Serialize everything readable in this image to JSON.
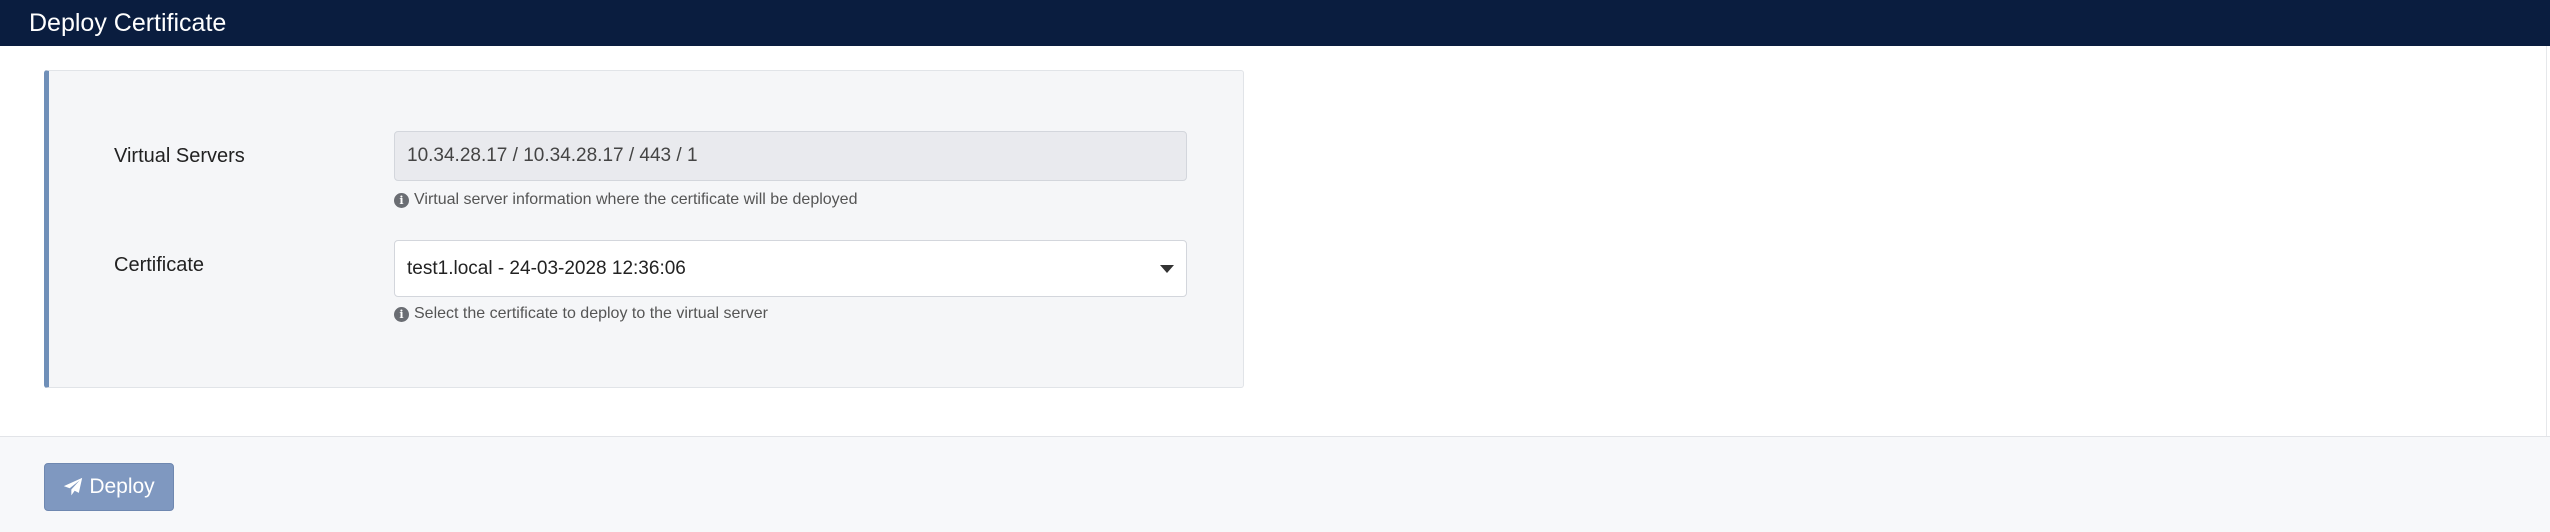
{
  "window": {
    "title": "Deploy Certificate"
  },
  "form": {
    "virtual_servers": {
      "label": "Virtual Servers",
      "value": "10.34.28.17 / 10.34.28.17 / 443 / 1",
      "help": "Virtual server information where the certificate will be deployed"
    },
    "certificate": {
      "label": "Certificate",
      "selected": "test1.local - 24-03-2028 12:36:06",
      "help": "Select the certificate to deploy to the virtual server"
    }
  },
  "footer": {
    "deploy_label": "Deploy"
  },
  "icons": {
    "info": "info-icon",
    "caret": "chevron-down-icon",
    "deploy": "paper-plane-icon"
  },
  "colors": {
    "titlebar": "#0a1d3f",
    "panel_accent": "#6f8fb8",
    "deploy_button": "#7f98c0"
  }
}
